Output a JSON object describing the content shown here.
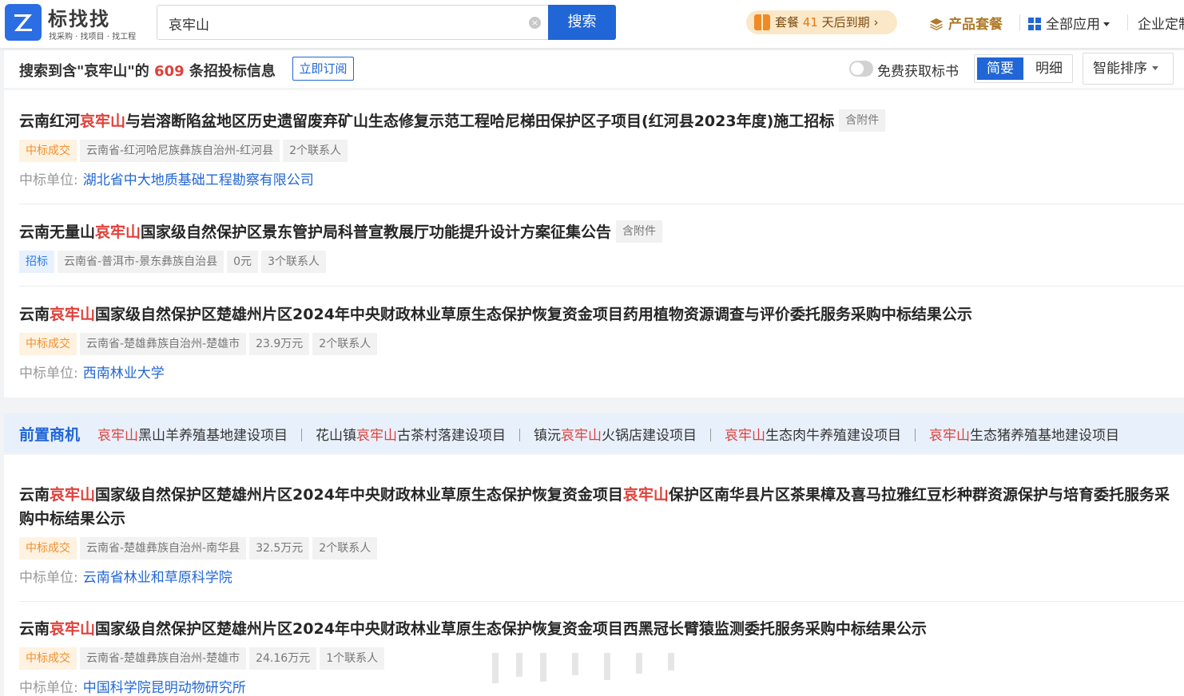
{
  "header": {
    "logo_text": "标找找",
    "logo_tagline": "找采购 · 找项目 · 找工程",
    "search_value": "哀牢山",
    "search_button": "搜索",
    "package_prefix": "套餐",
    "package_days": "41",
    "package_suffix": "天后到期",
    "nav_packages": "产品套餐",
    "nav_all_apps": "全部应用",
    "nav_enterprise": "企业定制"
  },
  "summary": {
    "prefix": "搜索到含\"哀牢山\"的",
    "count": "609",
    "suffix": "条招投标信息",
    "subscribe": "立即订阅",
    "free_toggle_label": "免费获取标书",
    "view_brief": "简要",
    "view_detail": "明细",
    "sort_label": "智能排序"
  },
  "labels": {
    "winner_label": "中标单位:",
    "attachment": "含附件",
    "pre_title": "前置商机"
  },
  "results": [
    {
      "title_parts": [
        "云南红河",
        "哀牢山",
        "与岩溶断陷盆地区历史遗留废弃矿山生态修复示范工程哈尼梯田保护区子项目(红河县2023年度)施工招标"
      ],
      "status": "中标成交",
      "region": "云南省-红河哈尼族彝族自治州-红河县",
      "contacts": "2个联系人",
      "winner": "湖北省中大地质基础工程勘察有限公司"
    },
    {
      "title_parts": [
        "云南无量山",
        "哀牢山",
        "国家级自然保护区景东管护局科普宣教展厅功能提升设计方案征集公告"
      ],
      "status": "招标",
      "region": "云南省-普洱市-景东彝族自治县",
      "amount": "0元",
      "contacts": "3个联系人"
    },
    {
      "title_parts": [
        "云南",
        "哀牢山",
        "国家级自然保护区楚雄州片区2024年中央财政林业草原生态保护恢复资金项目药用植物资源调查与评价委托服务采购中标结果公示"
      ],
      "status": "中标成交",
      "region": "云南省-楚雄彝族自治州-楚雄市",
      "amount": "23.9万元",
      "contacts": "2个联系人",
      "winner": "西南林业大学"
    },
    {
      "title_parts": [
        "云南",
        "哀牢山",
        "国家级自然保护区楚雄州片区2024年中央财政林业草原生态保护恢复资金项目",
        "哀牢山",
        "保护区南华县片区茶果樟及喜马拉雅红豆杉种群资源保护与培育委托服务采购中标结果公示"
      ],
      "status": "中标成交",
      "region": "云南省-楚雄彝族自治州-南华县",
      "amount": "32.5万元",
      "contacts": "2个联系人",
      "winner": "云南省林业和草原科学院"
    },
    {
      "title_parts": [
        "云南",
        "哀牢山",
        "国家级自然保护区楚雄州片区2024年中央财政林业草原生态保护恢复资金项目西黑冠长臂猿监测委托服务采购中标结果公示"
      ],
      "status": "中标成交",
      "region": "云南省-楚雄彝族自治州-楚雄市",
      "amount": "24.16万元",
      "contacts": "1个联系人",
      "winner": "中国科学院昆明动物研究所"
    }
  ],
  "pre_opportunities": [
    {
      "before": "",
      "hl": "哀牢山",
      "after": "黑山羊养殖基地建设项目"
    },
    {
      "before": "花山镇",
      "hl": "哀牢山",
      "after": "古茶村落建设项目"
    },
    {
      "before": "镇沅",
      "hl": "哀牢山",
      "after": "火锅店建设项目"
    },
    {
      "before": "",
      "hl": "哀牢山",
      "after": "生态肉牛养殖建设项目"
    },
    {
      "before": "",
      "hl": "哀牢山",
      "after": "生态猪养殖基地建设项目"
    }
  ],
  "colors": {
    "brand_blue": "#2166d6",
    "highlight_red": "#e0403a",
    "won_orange": "#f09030"
  }
}
